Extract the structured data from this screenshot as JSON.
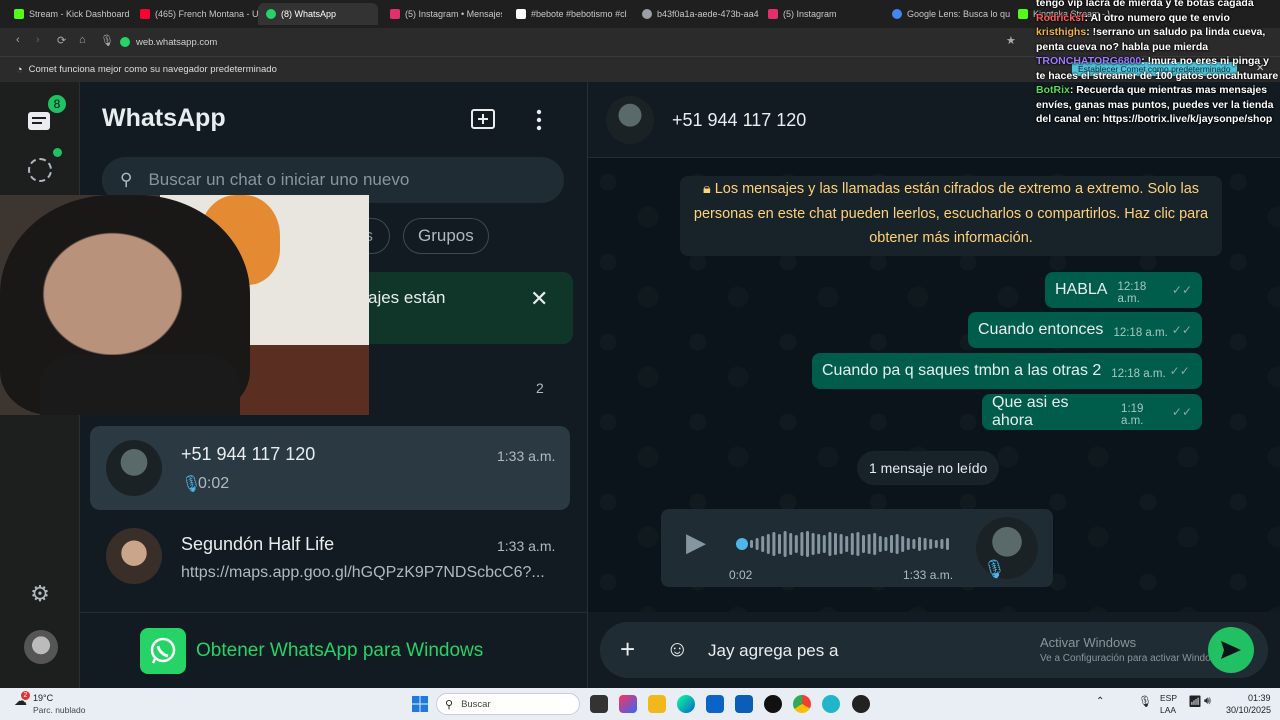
{
  "browser": {
    "tabs": [
      {
        "label": "Stream - Kick Dashboard",
        "color": "#53fc18"
      },
      {
        "label": "(465) French Montana - U",
        "color": "#ff0033"
      },
      {
        "label": "(8) WhatsApp",
        "color": "#25d366",
        "active": true
      },
      {
        "label": "(5) Instagram • Mensajes",
        "color": "#e1306c"
      },
      {
        "label": "#bebote #bebotismo #cl",
        "color": "#ffffff"
      },
      {
        "label": "b43f0a1a-aede-473b-aa4",
        "color": "#9aa0a6"
      },
      {
        "label": "(5) Instagram",
        "color": "#e1306c"
      },
      {
        "label": "Google Lens: Busca lo que",
        "color": "#4285f4"
      },
      {
        "label": "Kingteka Stream - Watch",
        "color": "#53fc18"
      }
    ],
    "url": "web.whatsapp.com",
    "infobar_text": "Comet funciona mejor como su navegador predeterminado",
    "set_default_button": "Establecer Comet como predeterminado"
  },
  "rail": {
    "chats_badge": "8"
  },
  "sidebar": {
    "title": "WhatsApp",
    "search_placeholder": "Buscar un chat o iniciar uno nuevo",
    "filters": [
      "os",
      "Grupos"
    ],
    "banner_text": "ajes están",
    "archived_count": "2",
    "chats": [
      {
        "name": "+51 944 117 120",
        "time": "1:33 a.m.",
        "preview": "0:02",
        "selected": true
      },
      {
        "name": "Segundón Half Life",
        "time": "1:33 a.m.",
        "preview": "https://maps.app.goo.gl/hGQPzK9P7NDScbcC6?..."
      }
    ],
    "get_app": "Obtener WhatsApp para Windows"
  },
  "chat": {
    "contact": "+51 944 117 120",
    "encryption_notice": "Los mensajes y las llamadas están cifrados de extremo a extremo. Solo las personas en este chat pueden leerlos, escucharlos o compartirlos. Haz clic para obtener más información.",
    "messages": [
      {
        "text": "HABLA",
        "time": "12:18 a.m."
      },
      {
        "text": "Cuando entonces",
        "time": "12:18 a.m."
      },
      {
        "text": "Cuando pa q saques tmbn a las otras 2",
        "time": "12:18 a.m."
      },
      {
        "text": "Que asi es ahora",
        "time": "1:19 a.m."
      }
    ],
    "unread_divider": "1 mensaje no leído",
    "voice_note": {
      "duration": "0:02",
      "time": "1:33 a.m.",
      "progress": 0
    },
    "composer_text": "Jay agrega pes a",
    "activate_windows_title": "Activar Windows",
    "activate_windows_sub": "Ve a Configuración para activar Windows"
  },
  "stream_chat": [
    {
      "user": "",
      "msg": "tengo vip lacra de mierda y te botas cagada",
      "cls": ""
    },
    {
      "user": "Rodricksf",
      "msg": ": Al otro numero que te envio",
      "cls": "red"
    },
    {
      "user": "kristhighs",
      "msg": ": !serrano un saludo pa linda cueva, penta cueva no? habla pue mierda",
      "cls": ""
    },
    {
      "user": "TRONCHATORG6800",
      "msg": ": !mura no eres ni pinga y te haces el streamer de 100 gatos concahtumare",
      "cls": "purple"
    },
    {
      "user": "BotRix",
      "msg": ": Recuerda que mientras mas mensajes envíes, ganas mas puntos, puedes ver la tienda del canal en: https://botrix.live/k/jaysonpe/shop",
      "cls": "green"
    }
  ],
  "taskbar": {
    "weather_temp": "19°C",
    "weather_desc": "Parc. nublado",
    "weather_badge": "2",
    "search": "Buscar",
    "lang1": "ESP",
    "lang2": "LAA",
    "time": "01:39",
    "date": "30/10/2025"
  }
}
